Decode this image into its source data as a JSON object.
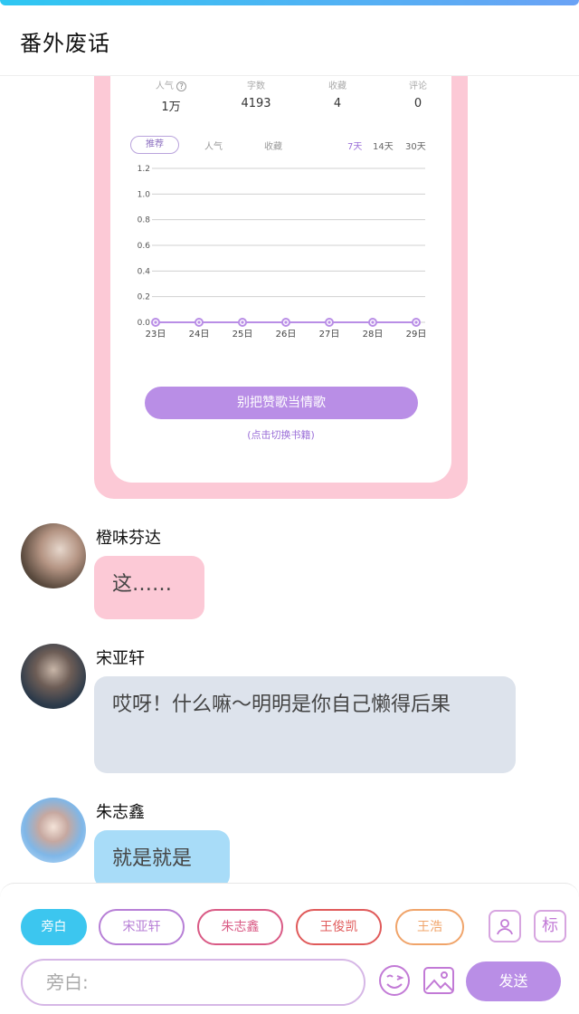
{
  "header": {
    "title": "番外废话"
  },
  "card": {
    "stats": [
      {
        "label": "人气",
        "value": "1万"
      },
      {
        "label": "字数",
        "value": "4193"
      },
      {
        "label": "收藏",
        "value": "4"
      },
      {
        "label": "评论",
        "value": "0"
      }
    ],
    "tabs": [
      "推荐",
      "人气",
      "收藏"
    ],
    "ranges": [
      "7天",
      "14天",
      "30天"
    ],
    "button": "别把赞歌当情歌",
    "switch_link": "(点击切换书籍)"
  },
  "chart_data": {
    "type": "line",
    "categories": [
      "23日",
      "24日",
      "25日",
      "26日",
      "27日",
      "28日",
      "29日"
    ],
    "series": [
      {
        "values": [
          0,
          0,
          0,
          0,
          0,
          0,
          0
        ]
      }
    ],
    "yticks": [
      "1.2",
      "1.0",
      "0.8",
      "0.6",
      "0.4",
      "0.2",
      "0.0"
    ],
    "ylim": [
      0,
      1.2
    ],
    "grid": true,
    "color": "#b98ee6"
  },
  "messages": [
    {
      "name": "橙味芬达",
      "text": "这……"
    },
    {
      "name": "宋亚轩",
      "text": "哎呀！什么嘛～明明是你自己懒得后果"
    },
    {
      "name": "朱志鑫",
      "text": "就是就是"
    }
  ],
  "composer": {
    "chips": [
      "旁白",
      "宋亚轩",
      "朱志鑫",
      "王俊凯",
      "王浩"
    ],
    "chip_colors": [
      "#3cc6ef",
      "#b77fd6",
      "#d95a85",
      "#e05a5a",
      "#f0a46a"
    ],
    "tag_icon_label": "标",
    "placeholder": "旁白:",
    "send": "发送"
  }
}
